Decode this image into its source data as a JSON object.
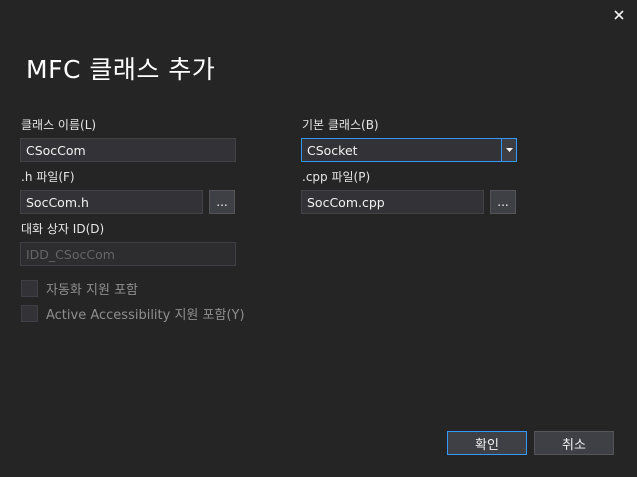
{
  "dialog": {
    "title": "MFC 클래스 추가",
    "close_icon": "close-icon"
  },
  "form": {
    "class_name_label": "클래스 이름(L)",
    "class_name_value": "CSocCom",
    "base_class_label": "기본 클래스(B)",
    "base_class_value": "CSocket",
    "h_file_label": ".h 파일(F)",
    "h_file_value": "SocCom.h",
    "cpp_file_label": ".cpp 파일(P)",
    "cpp_file_value": "SocCom.cpp",
    "browse_label": "...",
    "dialog_id_label": "대화 상자 ID(D)",
    "dialog_id_value": "IDD_CSocCom",
    "automation_label": "자동화 지원 포함",
    "accessibility_label": "Active Accessibility 지원 포함(Y)"
  },
  "buttons": {
    "ok_label": "확인",
    "cancel_label": "취소"
  },
  "colors": {
    "background": "#252526",
    "accent": "#3399ff",
    "input_bg": "#333337"
  }
}
